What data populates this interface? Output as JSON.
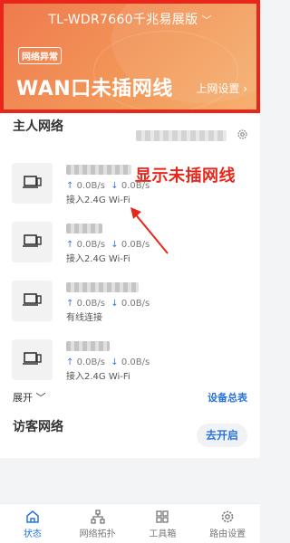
{
  "header": {
    "router_model": "TL-WDR7660千兆易展版",
    "status_badge": "网络异常",
    "wan_status": "WAN口未插网线",
    "net_settings": "上网设置 ›"
  },
  "main": {
    "section_title": "主人网络",
    "devices": [
      {
        "speed_up": "0.0B/s",
        "speed_down": "0.0B/s",
        "connection": "接入2.4G Wi-Fi"
      },
      {
        "speed_up": "0.0B/s",
        "speed_down": "0.0B/s",
        "connection": "接入2.4G Wi-Fi"
      },
      {
        "speed_up": "0.0B/s",
        "speed_down": "0.0B/s",
        "connection": "有线连接"
      },
      {
        "speed_up": "0.0B/s",
        "speed_down": "0.0B/s",
        "connection": "接入2.4G Wi-Fi"
      }
    ],
    "expand_label": "展开",
    "all_devices_label": "设备总表"
  },
  "annotation": {
    "text": "显示未插网线",
    "color": "#e8261a"
  },
  "guest": {
    "title": "访客网络",
    "open_button": "去开启"
  },
  "tabbar": {
    "tabs": [
      {
        "label": "状态",
        "icon": "home-icon",
        "active": true
      },
      {
        "label": "网络拓扑",
        "icon": "topology-icon",
        "active": false
      },
      {
        "label": "工具箱",
        "icon": "grid-icon",
        "active": false
      },
      {
        "label": "路由设置",
        "icon": "gear-icon",
        "active": false
      }
    ]
  },
  "colors": {
    "accent": "#2b74d9",
    "header_orange": "#f07a4e",
    "alert_red": "#e8261a"
  }
}
